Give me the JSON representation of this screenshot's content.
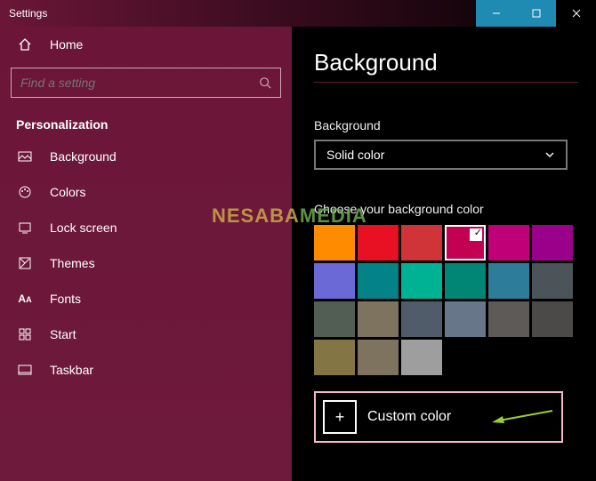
{
  "titlebar": {
    "label": "Settings"
  },
  "sidebar": {
    "home_label": "Home",
    "search_placeholder": "Find a setting",
    "category": "Personalization",
    "items": [
      {
        "label": "Background"
      },
      {
        "label": "Colors"
      },
      {
        "label": "Lock screen"
      },
      {
        "label": "Themes"
      },
      {
        "label": "Fonts"
      },
      {
        "label": "Start"
      },
      {
        "label": "Taskbar"
      }
    ]
  },
  "main": {
    "title": "Background",
    "bg_label": "Background",
    "dropdown_value": "Solid color",
    "choose_label": "Choose your background color",
    "custom_label": "Custom color",
    "swatches": [
      "#ff8c00",
      "#e81123",
      "#d13438",
      "#c30052",
      "#bf0077",
      "#9a0089",
      "#6b69d6",
      "#038387",
      "#00b294",
      "#018574",
      "#2d7d9a",
      "#4a5459",
      "#525e54",
      "#7e735f",
      "#515c6b",
      "#68768a",
      "#5d5a58",
      "#4c4a48",
      "#847545",
      "#7e735f",
      "#9e9e9e"
    ],
    "selected_index": 3
  },
  "watermark": {
    "part1": "NESABA",
    "part2": "MEDIA"
  }
}
